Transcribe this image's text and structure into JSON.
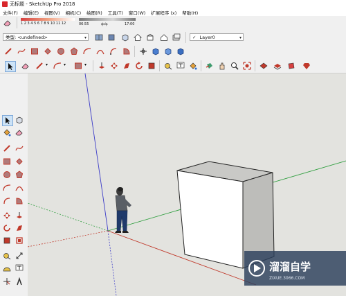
{
  "window": {
    "title": "无标题 - SketchUp Pro 2018"
  },
  "menu": {
    "items": [
      {
        "label": "文件(F)"
      },
      {
        "label": "编辑(E)"
      },
      {
        "label": "视图(V)"
      },
      {
        "label": "相机(C)"
      },
      {
        "label": "绘图(R)"
      },
      {
        "label": "工具(T)"
      },
      {
        "label": "窗口(W)"
      },
      {
        "label": "扩展程序 (x)"
      },
      {
        "label": "帮助(H)"
      }
    ]
  },
  "shadow": {
    "months": "1 2 3 4 5 6 7 8 9 10 11 12",
    "time_start": "06:55",
    "noon": "中午",
    "time_end": "17:00"
  },
  "toolbar2": {
    "type_label": "类型: <undefined>",
    "layer_value": "Layer0"
  },
  "watermark": {
    "brand": "溜溜自学",
    "url": "ZIXUE.3066.COM"
  },
  "colors": {
    "accent_red": "#d8262c",
    "viewport_bg": "#e3e3df",
    "axis_red": "#c0392b",
    "axis_green": "#2e9e3e",
    "axis_blue": "#3a3ac8"
  }
}
